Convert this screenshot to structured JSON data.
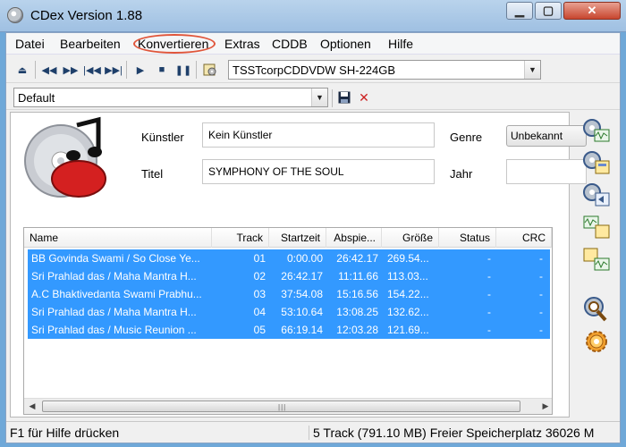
{
  "window": {
    "title": "CDex Version 1.88"
  },
  "menu": [
    "Datei",
    "Bearbeiten",
    "Konvertieren",
    "Extras",
    "CDDB",
    "Optionen",
    "Hilfe"
  ],
  "drive": {
    "selected": "TSSTcorpCDDVDW SH-224GB"
  },
  "profile": {
    "selected": "Default"
  },
  "album": {
    "artist_label": "Künstler",
    "artist": "Kein Künstler",
    "title_label": "Titel",
    "title": "SYMPHONY OF THE SOUL",
    "genre_label": "Genre",
    "genre": "Unbekannt",
    "year_label": "Jahr",
    "year": ""
  },
  "table": {
    "columns": [
      "Name",
      "Track",
      "Startzeit",
      "Abspie...",
      "Größe",
      "Status",
      "CRC"
    ],
    "rows": [
      {
        "name": "BB Govinda Swami / So Close Ye...",
        "track": "01",
        "start": "0:00.00",
        "duration": "26:42.17",
        "size": "269.54...",
        "status": "-",
        "crc": "-"
      },
      {
        "name": "Sri Prahlad das / Maha Mantra H...",
        "track": "02",
        "start": "26:42.17",
        "duration": "11:11.66",
        "size": "113.03...",
        "status": "-",
        "crc": "-"
      },
      {
        "name": "A.C Bhaktivedanta Swami Prabhu...",
        "track": "03",
        "start": "37:54.08",
        "duration": "15:16.56",
        "size": "154.22...",
        "status": "-",
        "crc": "-"
      },
      {
        "name": "Sri Prahlad das / Maha Mantra H...",
        "track": "04",
        "start": "53:10.64",
        "duration": "13:08.25",
        "size": "132.62...",
        "status": "-",
        "crc": "-"
      },
      {
        "name": "Sri Prahlad das / Music Reunion ...",
        "track": "05",
        "start": "66:19.14",
        "duration": "12:03.28",
        "size": "121.69...",
        "status": "-",
        "crc": "-"
      }
    ]
  },
  "status": {
    "left": "F1 für Hilfe drücken",
    "right": "5 Track (791.10 MB) Freier Speicherplatz 36026 M"
  },
  "colors": {
    "selection": "#3399ff",
    "accent_circle": "#e0553a"
  }
}
